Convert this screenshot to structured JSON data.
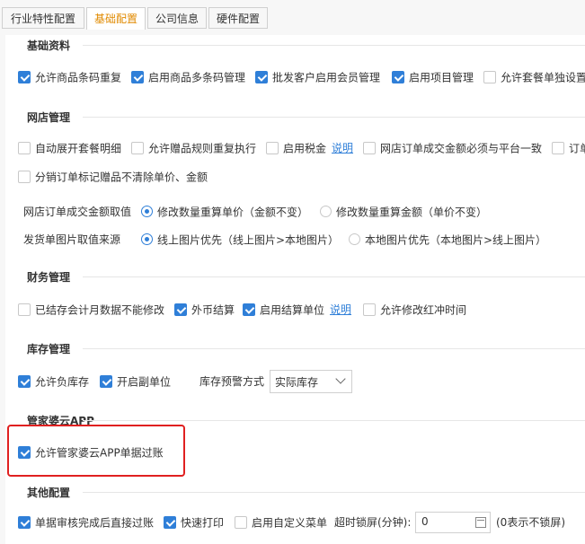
{
  "tabs": [
    "行业特性配置",
    "基础配置",
    "公司信息",
    "硬件配置"
  ],
  "active_tab": "基础配置",
  "basic": {
    "title": "基础资料",
    "items": [
      {
        "label": "允许商品条码重复",
        "checked": true
      },
      {
        "label": "启用商品多条码管理",
        "checked": true
      },
      {
        "label": "批发客户启用会员管理",
        "checked": true
      },
      {
        "label": "启用项目管理",
        "checked": true
      },
      {
        "label": "允许套餐单独设置",
        "checked": false
      }
    ]
  },
  "shop": {
    "title": "网店管理",
    "row1": [
      {
        "label": "自动展开套餐明细",
        "checked": false
      },
      {
        "label": "允许赠品规则重复执行",
        "checked": false
      },
      {
        "label": "启用税金",
        "checked": false,
        "link": "说明"
      },
      {
        "label": "网店订单成交金额必须与平台一致",
        "checked": false
      },
      {
        "label": "订单",
        "checked": false
      }
    ],
    "row2": {
      "label": "分销订单标记赠品不清除单价、金额",
      "checked": false
    },
    "amount_source": {
      "label": "网店订单成交金额取值",
      "options": [
        {
          "label": "修改数量重算单价（金额不变）",
          "selected": true
        },
        {
          "label": "修改数量重算金额（单价不变）",
          "selected": false
        }
      ]
    },
    "image_source": {
      "label": "发货单图片取值来源",
      "options": [
        {
          "label": "线上图片优先（线上图片>本地图片）",
          "selected": true
        },
        {
          "label": "本地图片优先（本地图片>线上图片）",
          "selected": false
        }
      ]
    }
  },
  "finance": {
    "title": "财务管理",
    "items": [
      {
        "label": "已结存会计月数据不能修改",
        "checked": false
      },
      {
        "label": "外币结算",
        "checked": true
      },
      {
        "label": "启用结算单位",
        "checked": true,
        "link": "说明"
      },
      {
        "label": "允许修改红冲时间",
        "checked": false
      }
    ]
  },
  "stock": {
    "title": "库存管理",
    "items": [
      {
        "label": "允许负库存",
        "checked": true
      },
      {
        "label": "开启副单位",
        "checked": true
      }
    ],
    "warn_label": "库存预警方式",
    "warn_value": "实际库存"
  },
  "app": {
    "title": "管家婆云APP",
    "item": {
      "label": "允许管家婆云APP单据过账",
      "checked": true
    }
  },
  "other": {
    "title": "其他配置",
    "items": [
      {
        "label": "单据审核完成后直接过账",
        "checked": true
      },
      {
        "label": "快速打印",
        "checked": true
      },
      {
        "label": "启用自定义菜单",
        "checked": false
      }
    ],
    "lock_label": "超时锁屏(分钟):",
    "lock_value": "0",
    "lock_hint": "(0表示不锁屏)"
  },
  "colors": {
    "accent": "#2f7fd8",
    "active_tab": "#e08a00",
    "highlight": "#e02020"
  }
}
